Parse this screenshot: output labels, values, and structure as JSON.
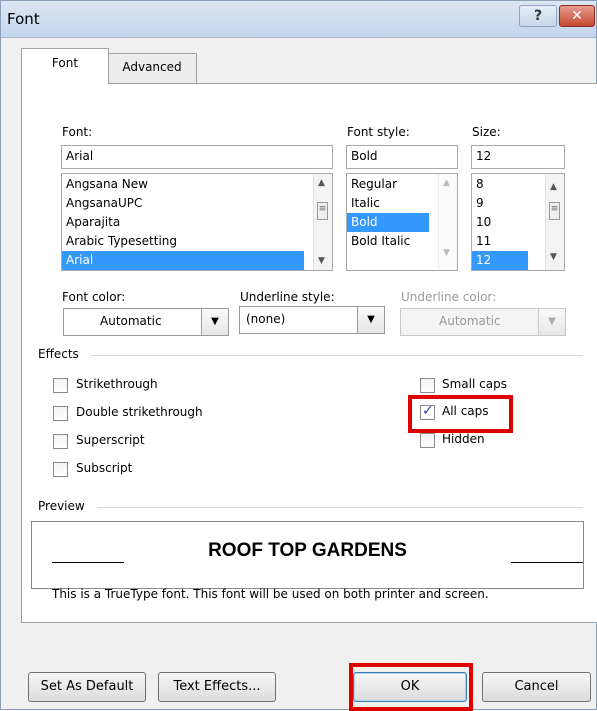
{
  "window": {
    "title": "Font",
    "help_label": "?",
    "close_label": "✕"
  },
  "tabs": [
    {
      "label": "Font"
    },
    {
      "label": "Advanced"
    }
  ],
  "font": {
    "label": "Font:",
    "value": "Arial",
    "items": [
      "Angsana New",
      "AngsanaUPC",
      "Aparajita",
      "Arabic Typesetting",
      "Arial"
    ],
    "selected": "Arial"
  },
  "style": {
    "label": "Font style:",
    "value": "Bold",
    "items": [
      "Regular",
      "Italic",
      "Bold",
      "Bold Italic"
    ],
    "selected": "Bold"
  },
  "size": {
    "label": "Size:",
    "value": "12",
    "items": [
      "8",
      "9",
      "10",
      "11",
      "12"
    ],
    "selected": "12"
  },
  "font_color": {
    "label": "Font color:",
    "value": "Automatic"
  },
  "underline_style": {
    "label": "Underline style:",
    "value": "(none)"
  },
  "underline_color": {
    "label": "Underline color:",
    "value": "Automatic"
  },
  "effects": {
    "title": "Effects",
    "left": [
      {
        "label": "Strikethrough",
        "checked": false
      },
      {
        "label": "Double strikethrough",
        "checked": false
      },
      {
        "label": "Superscript",
        "checked": false
      },
      {
        "label": "Subscript",
        "checked": false
      }
    ],
    "right": [
      {
        "label": "Small caps",
        "checked": false
      },
      {
        "label": "All caps",
        "checked": true
      },
      {
        "label": "Hidden",
        "checked": false
      }
    ]
  },
  "preview": {
    "title": "Preview",
    "sample": "ROOF TOP GARDENS",
    "note": "This is a TrueType font. This font will be used on both printer and screen."
  },
  "buttons": {
    "set_default": "Set As Default",
    "text_effects": "Text Effects...",
    "ok": "OK",
    "cancel": "Cancel"
  },
  "colors": {
    "highlight": "#e00000",
    "selection": "#3399ff"
  }
}
